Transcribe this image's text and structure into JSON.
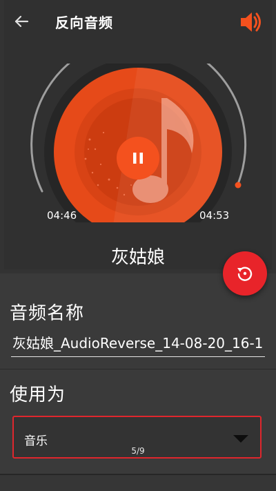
{
  "header": {
    "title": "反向音频"
  },
  "player": {
    "song_title": "灰姑娘",
    "time_elapsed": "04:46",
    "time_total": "04:53",
    "progress": 0.976,
    "state": "playing"
  },
  "form": {
    "name_label": "音频名称",
    "name_value": "灰姑娘_AudioReverse_14-08-20_16-1",
    "use_label": "使用为",
    "use_selected": "音乐"
  },
  "pager": {
    "text": "5/9"
  },
  "icons": {
    "back": "arrow-left-icon",
    "volume": "volume-up-icon",
    "pause": "pause-icon",
    "replay": "replay-icon",
    "dropdown": "triangle-down-icon",
    "music_note": "music-note-icon"
  },
  "colors": {
    "accent": "#f4511e",
    "disc_outer": "#e64a19",
    "fab": "#e8242a",
    "select_border": "#e0262d",
    "background": "#303030"
  }
}
